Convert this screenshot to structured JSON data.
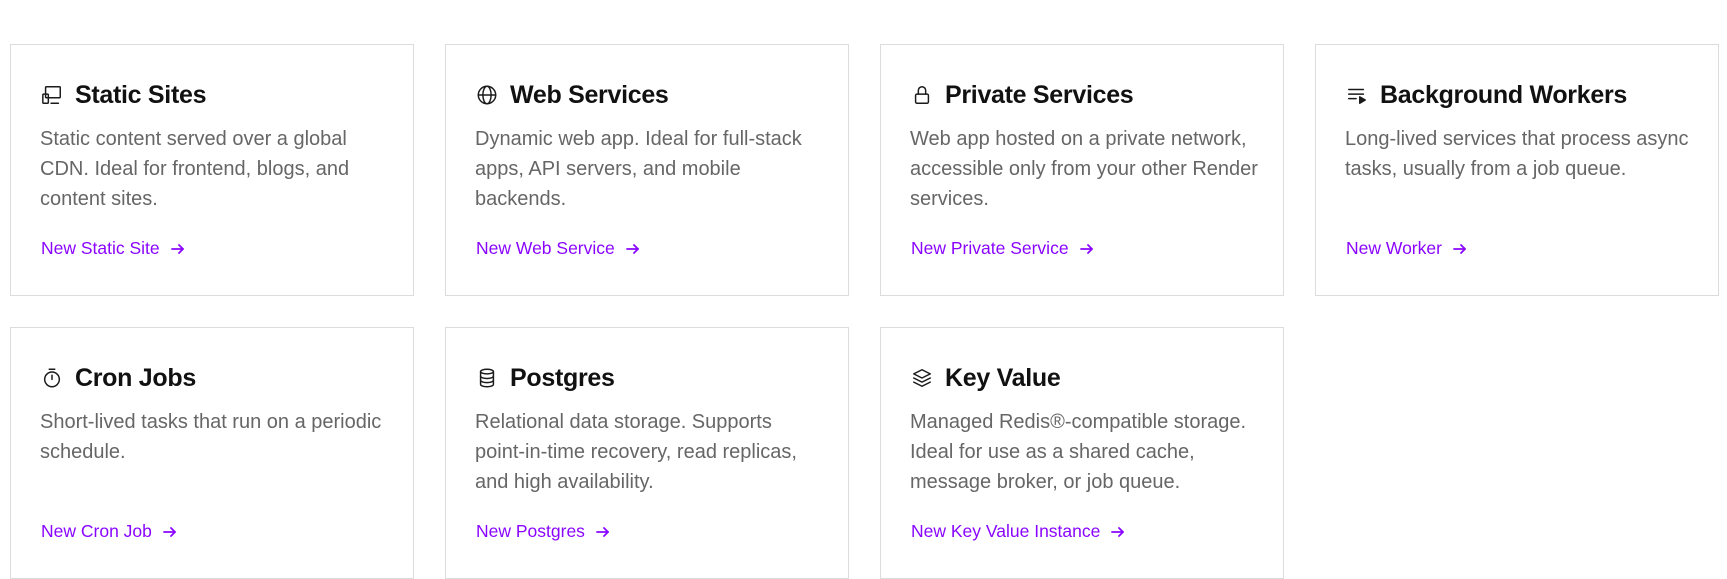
{
  "cards": [
    {
      "id": "static-sites",
      "icon": "static-site-icon",
      "title": "Static Sites",
      "description": "Static content served over a global CDN. Ideal for frontend, blogs, and content sites.",
      "link": "New Static Site"
    },
    {
      "id": "web-services",
      "icon": "globe-icon",
      "title": "Web Services",
      "description": "Dynamic web app. Ideal for full-stack apps, API servers, and mobile backends.",
      "link": "New Web Service"
    },
    {
      "id": "private-services",
      "icon": "lock-icon",
      "title": "Private Services",
      "description": "Web app hosted on a private network, accessible only from your other Render services.",
      "link": "New Private Service"
    },
    {
      "id": "background-workers",
      "icon": "queue-list-icon",
      "title": "Background Workers",
      "description": "Long-lived services that process async tasks, usually from a job queue.",
      "link": "New Worker"
    },
    {
      "id": "cron-jobs",
      "icon": "stopwatch-icon",
      "title": "Cron Jobs",
      "description": "Short-lived tasks that run on a periodic schedule.",
      "link": "New Cron Job"
    },
    {
      "id": "postgres",
      "icon": "database-icon",
      "title": "Postgres",
      "description": "Relational data storage. Supports point-in-time recovery, read replicas, and high availability.",
      "link": "New Postgres"
    },
    {
      "id": "key-value",
      "icon": "layers-icon",
      "title": "Key Value",
      "description": "Managed Redis®-compatible storage. Ideal for use as a shared cache, message broker, or job queue.",
      "link": "New Key Value Instance"
    }
  ],
  "colors": {
    "link": "#8a05ff",
    "title": "#111111",
    "description": "#666666",
    "border": "#dcdcdc"
  }
}
